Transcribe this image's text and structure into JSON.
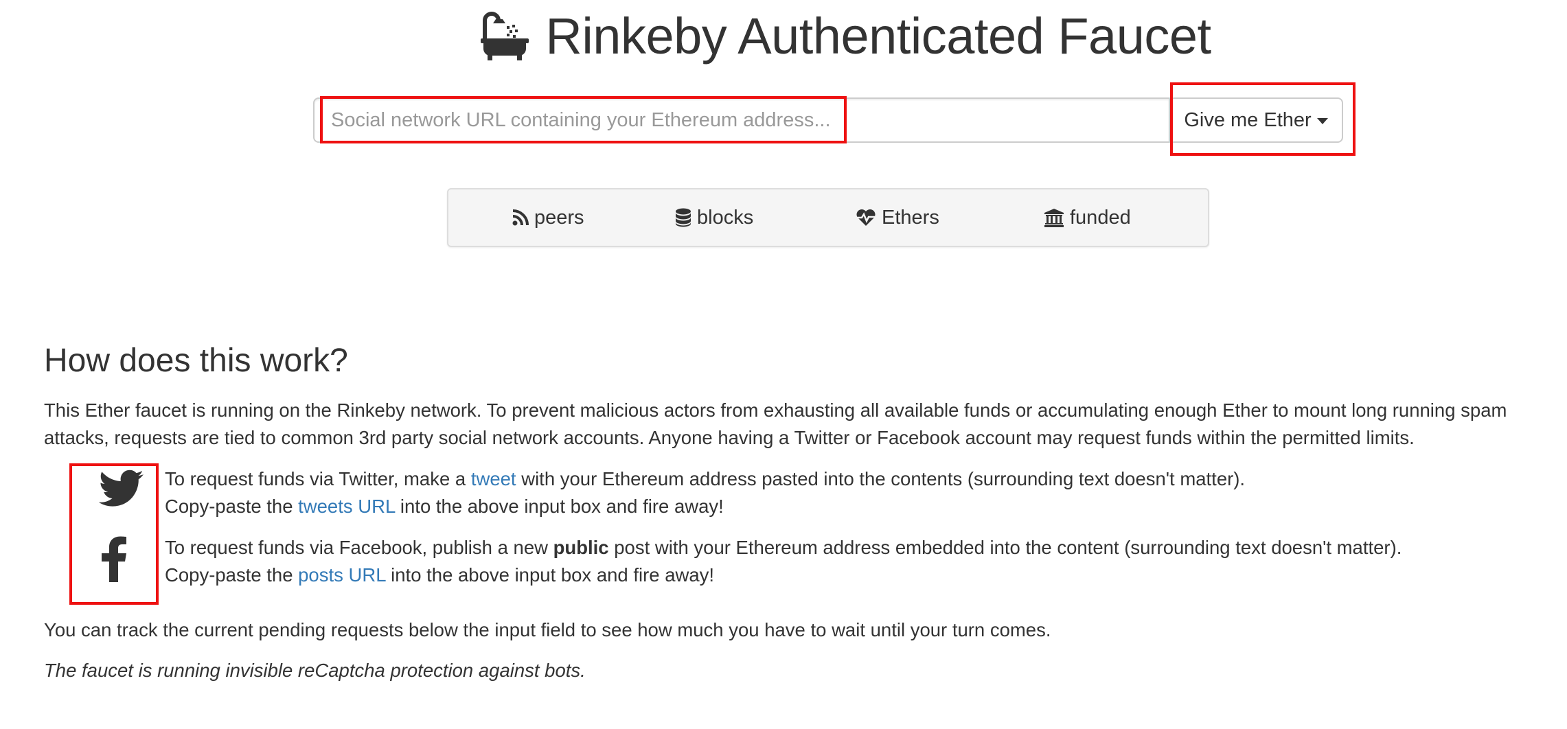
{
  "header": {
    "title": "Rinkeby Authenticated Faucet",
    "icon": "bath-icon"
  },
  "request": {
    "placeholder": "Social network URL containing your Ethereum address...",
    "value": "",
    "button_label": "Give me Ether"
  },
  "stats": {
    "items": [
      {
        "icon": "rss-icon",
        "label": "peers"
      },
      {
        "icon": "database-icon",
        "label": "blocks"
      },
      {
        "icon": "heartbeat-icon",
        "label": "Ethers"
      },
      {
        "icon": "bank-icon",
        "label": "funded"
      }
    ]
  },
  "info": {
    "heading": "How does this work?",
    "intro_line1": "This Ether faucet is running on the Rinkeby network. To prevent malicious actors from exhausting all available funds or accumulating enough Ether to mount long running spam",
    "intro_line2": "attacks, requests are tied to common 3rd party social network accounts. Anyone having a Twitter or Facebook account may request funds within the permitted limits.",
    "twitter": {
      "icon": "twitter-icon",
      "line1_before": "To request funds via Twitter, make a ",
      "line1_link": "tweet",
      "line1_after": " with your Ethereum address pasted into the contents (surrounding text doesn't matter).",
      "line2_before": "Copy-paste the ",
      "line2_link": "tweets URL",
      "line2_after": " into the above input box and fire away!"
    },
    "facebook": {
      "icon": "facebook-icon",
      "line1_before": "To request funds via Facebook, publish a new ",
      "line1_bold": "public",
      "line1_after": " post with your Ethereum address embedded into the content (surrounding text doesn't matter).",
      "line2_before": "Copy-paste the ",
      "line2_link": "posts URL",
      "line2_after": " into the above input box and fire away!"
    },
    "tracking": "You can track the current pending requests below the input field to see how much you have to wait until your turn comes.",
    "recaptcha": "The faucet is running invisible reCaptcha protection against bots."
  },
  "colors": {
    "link": "#337ab7",
    "highlight": "#ee1111",
    "text": "#333333"
  }
}
